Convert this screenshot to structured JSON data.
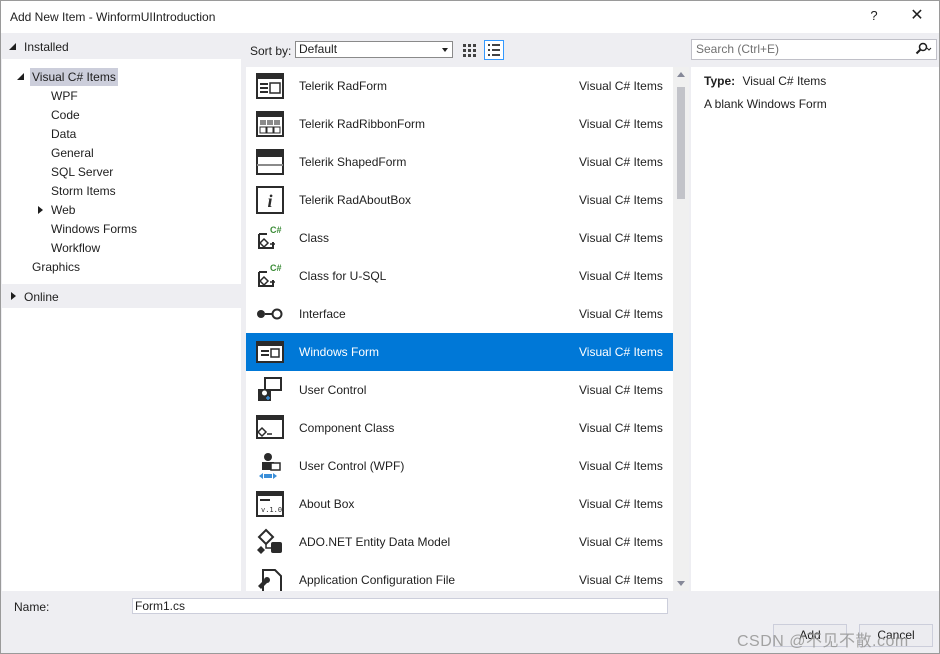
{
  "window": {
    "title": "Add New Item - WinformUIIntroduction",
    "help_label": "?",
    "close_label": "✕"
  },
  "tree": {
    "installed": "Installed",
    "visual_csharp": "Visual C# Items",
    "children": [
      "WPF",
      "Code",
      "Data",
      "General",
      "SQL Server",
      "Storm Items",
      "Web",
      "Windows Forms",
      "Workflow"
    ],
    "graphics": "Graphics",
    "online": "Online"
  },
  "toolbar": {
    "sort_label": "Sort by:",
    "sort_value": "Default"
  },
  "search": {
    "placeholder": "Search (Ctrl+E)"
  },
  "templates": [
    {
      "name": "Telerik RadForm",
      "category": "Visual C# Items",
      "icon": "radform-icon"
    },
    {
      "name": "Telerik RadRibbonForm",
      "category": "Visual C# Items",
      "icon": "ribbonform-icon"
    },
    {
      "name": "Telerik ShapedForm",
      "category": "Visual C# Items",
      "icon": "shapedform-icon"
    },
    {
      "name": "Telerik RadAboutBox",
      "category": "Visual C# Items",
      "icon": "info-icon"
    },
    {
      "name": "Class",
      "category": "Visual C# Items",
      "icon": "class-icon"
    },
    {
      "name": "Class for U-SQL",
      "category": "Visual C# Items",
      "icon": "class-icon"
    },
    {
      "name": "Interface",
      "category": "Visual C# Items",
      "icon": "interface-icon"
    },
    {
      "name": "Windows Form",
      "category": "Visual C# Items",
      "icon": "windows-form-icon"
    },
    {
      "name": "User Control",
      "category": "Visual C# Items",
      "icon": "user-control-icon"
    },
    {
      "name": "Component Class",
      "category": "Visual C# Items",
      "icon": "component-icon"
    },
    {
      "name": "User Control (WPF)",
      "category": "Visual C# Items",
      "icon": "wpf-user-control-icon"
    },
    {
      "name": "About Box",
      "category": "Visual C# Items",
      "icon": "about-box-icon"
    },
    {
      "name": "ADO.NET Entity Data Model",
      "category": "Visual C# Items",
      "icon": "entity-model-icon"
    },
    {
      "name": "Application Configuration File",
      "category": "Visual C# Items",
      "icon": "config-file-icon"
    }
  ],
  "selected_template": "Windows Form",
  "details": {
    "type_label": "Type:",
    "type_value": "Visual C# Items",
    "description": "A blank Windows Form"
  },
  "bottom": {
    "name_label": "Name:",
    "name_value": "Form1.cs",
    "add_label": "Add",
    "cancel_label": "Cancel"
  },
  "watermark": "CSDN @不见不散.com",
  "colors": {
    "selection": "#0078d7",
    "dialog_bg": "#eeeef2",
    "tree_selected": "#cccedb"
  }
}
